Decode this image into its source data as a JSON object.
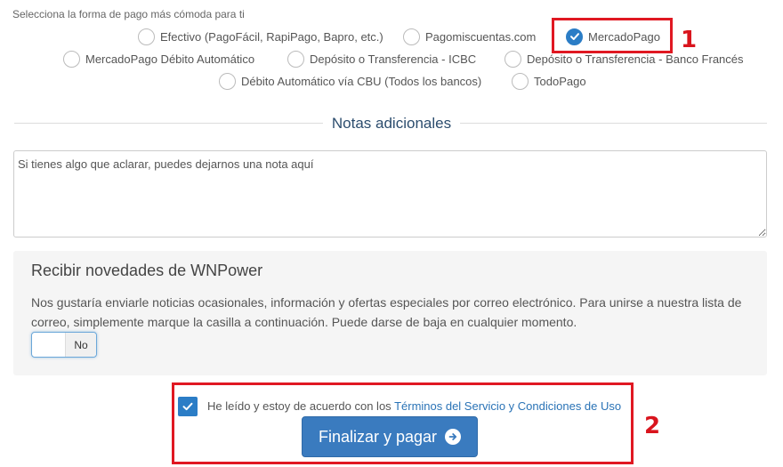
{
  "payment": {
    "prompt": "Selecciona la forma de pago más cómoda para ti",
    "options": [
      {
        "label": "Efectivo (PagoFácil, RapiPago, Bapro, etc.)"
      },
      {
        "label": "Pagomiscuentas.com"
      },
      {
        "label": "MercadoPago",
        "selected": true
      },
      {
        "label": "MercadoPago Débito Automático"
      },
      {
        "label": "Depósito o Transferencia - ICBC"
      },
      {
        "label": "Depósito o Transferencia - Banco Francés"
      },
      {
        "label": "Débito Automático vía CBU (Todos los bancos)"
      },
      {
        "label": "TodoPago"
      }
    ]
  },
  "annotations": {
    "step1": "1",
    "step2": "2",
    "color": "#e01822"
  },
  "notes": {
    "title": "Notas adicionales",
    "placeholder": "Si tienes algo que aclarar, puedes dejarnos una nota aquí"
  },
  "newsletter": {
    "title": "Recibir novedades de WNPower",
    "text": "Nos gustaría enviarle noticias ocasionales, información y ofertas especiales por correo electrónico. Para unirse a nuestra lista de correo, simplemente marque la casilla a continuación. Puede darse de baja en cualquier momento.",
    "toggle_label": "No"
  },
  "terms": {
    "prefix": "He leído y estoy de acuerdo con los ",
    "link": "Términos del Servicio y Condiciones de Uso",
    "checked": true
  },
  "submit": {
    "label": "Finalizar y pagar"
  },
  "colors": {
    "accent": "#2b7dc6",
    "button": "#3a7bbf",
    "heading": "#2c4d6e"
  }
}
